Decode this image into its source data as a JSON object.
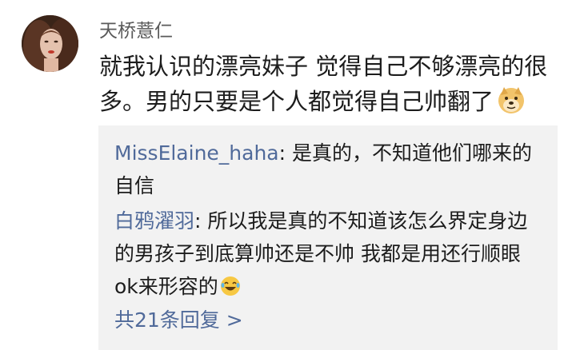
{
  "comment": {
    "username": "天桥薏仁",
    "text": "就我认识的漂亮妹子 觉得自己不够漂亮的很多。男的只要是个人都觉得自己帅翻了",
    "trailing_emoji": "doge-emoji",
    "avatar": "user-avatar-photo"
  },
  "replies": [
    {
      "author": "MissElaine_haha",
      "separator": ": ",
      "text": "是真的，不知道他们哪来的自信"
    },
    {
      "author": "白鸦濯羽",
      "separator": ": ",
      "text": "所以我是真的不知道该怎么界定身边的男孩子到底算帅还是不帅 我都是用还行顺眼 ok来形容的",
      "trailing_emoji": "laughing-tears-emoji"
    }
  ],
  "more_replies": {
    "label": "共21条回复 >"
  },
  "colors": {
    "link_blue": "#506a9a",
    "reply_background": "#f2f2f2",
    "username_gray": "#5a5a5a"
  }
}
